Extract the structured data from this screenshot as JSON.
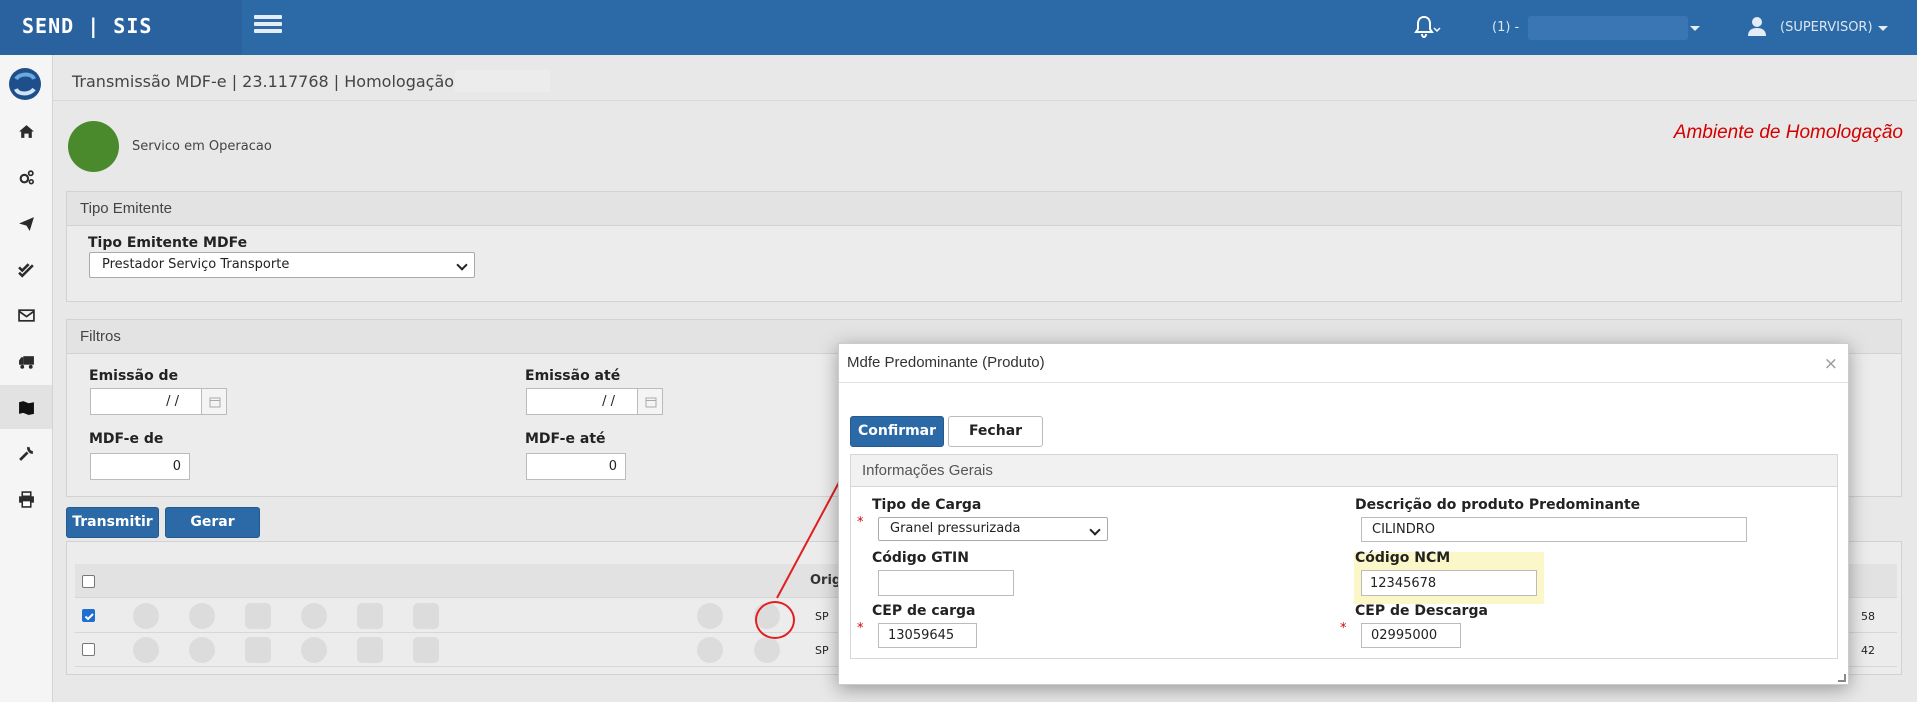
{
  "topbar": {
    "brand": "SEND | SIS",
    "company_prefix": "(1) -",
    "user": "(SUPERVISOR)"
  },
  "sidebar": {
    "items": [
      "home-icon",
      "cogs-icon",
      "paper-plane-icon",
      "double-check-icon",
      "envelope-icon",
      "truck-icon",
      "map-icon",
      "wrench-icon",
      "print-icon"
    ],
    "active": "map-icon"
  },
  "page": {
    "breadcrumb": "Transmissão MDF-e | 23.117768 | Homologação |",
    "status_text": "Servico em Operacao",
    "status_color": "#4b8a2c",
    "ambiente": "Ambiente de Homologação"
  },
  "tipo_emitente": {
    "panel_title": "Tipo Emitente",
    "label": "Tipo Emitente MDFe",
    "value": "Prestador Serviço Transporte"
  },
  "filtros": {
    "panel_title": "Filtros",
    "emissao_de_label": "Emissão de",
    "emissao_de_value": "/ /",
    "emissao_ate_label": "Emissão até",
    "emissao_ate_value": "/ /",
    "mdfe_de_label": "MDF-e de",
    "mdfe_de_value": "0",
    "mdfe_ate_label": "MDF-e até",
    "mdfe_ate_value": "0"
  },
  "actions": {
    "transmitir": "Transmitir",
    "gerar": "Gerar"
  },
  "table": {
    "origin_header": "Orig",
    "rows": [
      {
        "checked": true,
        "uf": "SP",
        "tail": "58"
      },
      {
        "checked": false,
        "uf": "SP",
        "tail": "42"
      }
    ]
  },
  "modal": {
    "title": "Mdfe Predominante (Produto)",
    "close": "×",
    "confirmar": "Confirmar",
    "fechar": "Fechar",
    "section_title": "Informações Gerais",
    "tipo_carga_label": "Tipo de Carga",
    "tipo_carga_value": "Granel pressurizada",
    "descricao_label": "Descrição do produto Predominante",
    "descricao_value": "CILINDRO",
    "gtin_label": "Código GTIN",
    "gtin_value": "",
    "ncm_label": "Código NCM",
    "ncm_value": "12345678",
    "cep_carga_label": "CEP de carga",
    "cep_carga_value": "13059645",
    "cep_descarga_label": "CEP de Descarga",
    "cep_descarga_value": "02995000",
    "required_mark": "*"
  },
  "colors": {
    "primary": "#2c69a7",
    "ambiente": "#d40000",
    "annotation": "#e02020",
    "ncm_highlight": "#fbf7c8"
  }
}
